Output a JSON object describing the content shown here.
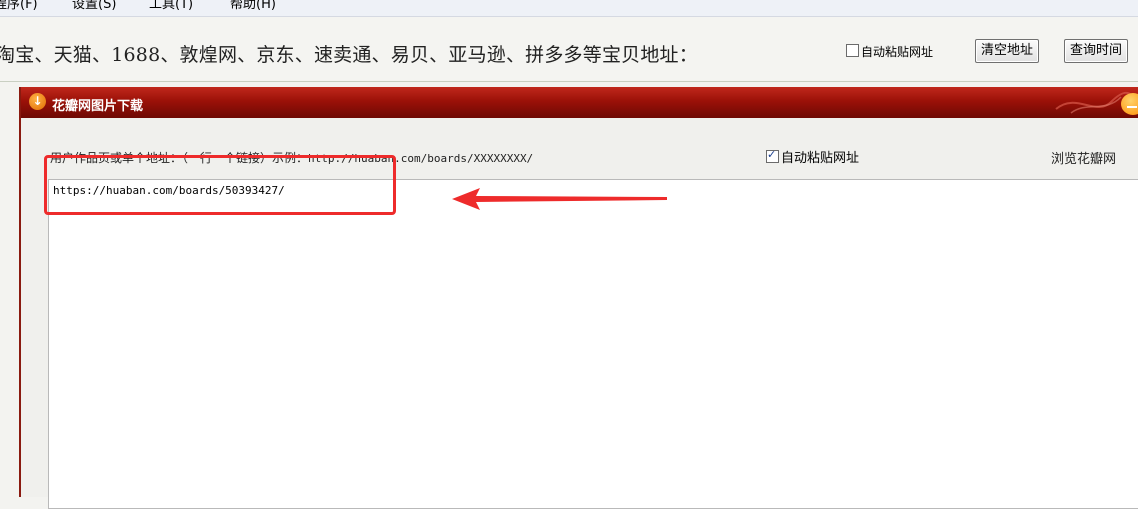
{
  "menu": {
    "items": [
      {
        "label": "程序(F)"
      },
      {
        "label": "设置(S)"
      },
      {
        "label": "工具(T)"
      },
      {
        "label": "帮助(H)"
      }
    ]
  },
  "hint": {
    "text": "淘宝、天猫、1688、敦煌网、京东、速卖通、易贝、亚马逊、拼多多等宝贝地址：",
    "auto_paste_label": "自动粘贴网址",
    "auto_paste_checked": false,
    "clear_button": "清空地址",
    "query_button": "查询时间"
  },
  "child": {
    "title": "花瓣网图片下载",
    "instruction_prefix": "用户作品页或单个地址：（一行一个链接）示例：",
    "instruction_example": "http://huaban.com/boards/XXXXXXXX/",
    "auto_paste_label": "自动粘贴网址",
    "auto_paste_checked": true,
    "browse_link": "浏览花瓣网",
    "url_value": "https://huaban.com/boards/50393427/"
  },
  "colors": {
    "titlebar": "#9b1108",
    "annotation": "#ee2b2b"
  }
}
